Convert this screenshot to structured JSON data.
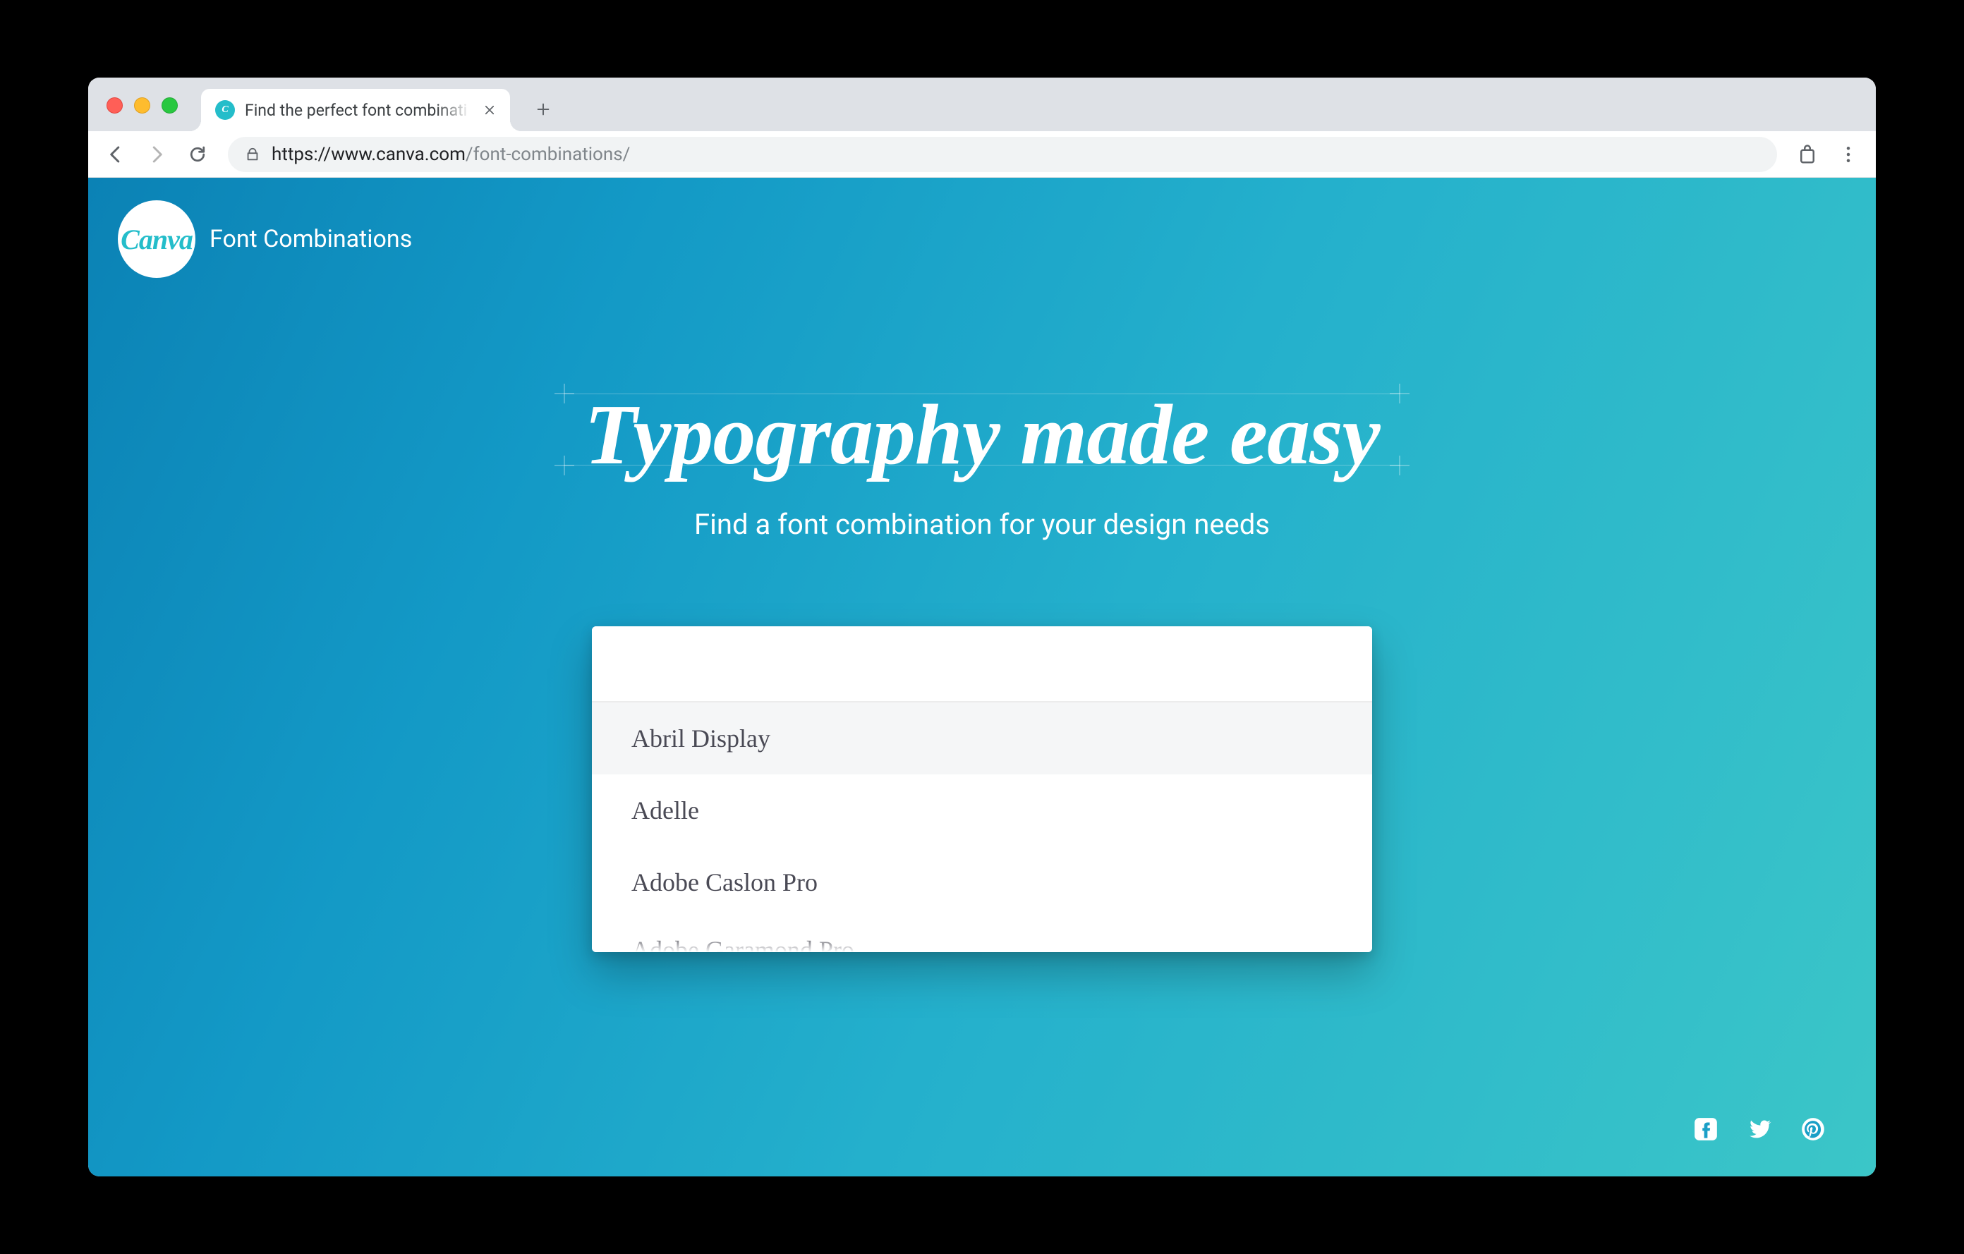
{
  "browser": {
    "tab_title": "Find the perfect font combinati",
    "url_scheme_host": "https://www.canva.com",
    "url_path": "/font-combinations/"
  },
  "header": {
    "logo_text": "Canva",
    "site_title": "Font Combinations"
  },
  "hero": {
    "title": "Typography made easy",
    "subtitle": "Find a font combination for your design needs"
  },
  "search": {
    "value": "",
    "placeholder": "",
    "options": [
      {
        "label": "Abril Display",
        "highlighted": true
      },
      {
        "label": "Adelle",
        "highlighted": false
      },
      {
        "label": "Adobe Caslon Pro",
        "highlighted": false
      },
      {
        "label": "Adobe Garamond Pro",
        "highlighted": false
      }
    ]
  },
  "social": {
    "facebook": "facebook-icon",
    "twitter": "twitter-icon",
    "pinterest": "pinterest-icon"
  }
}
